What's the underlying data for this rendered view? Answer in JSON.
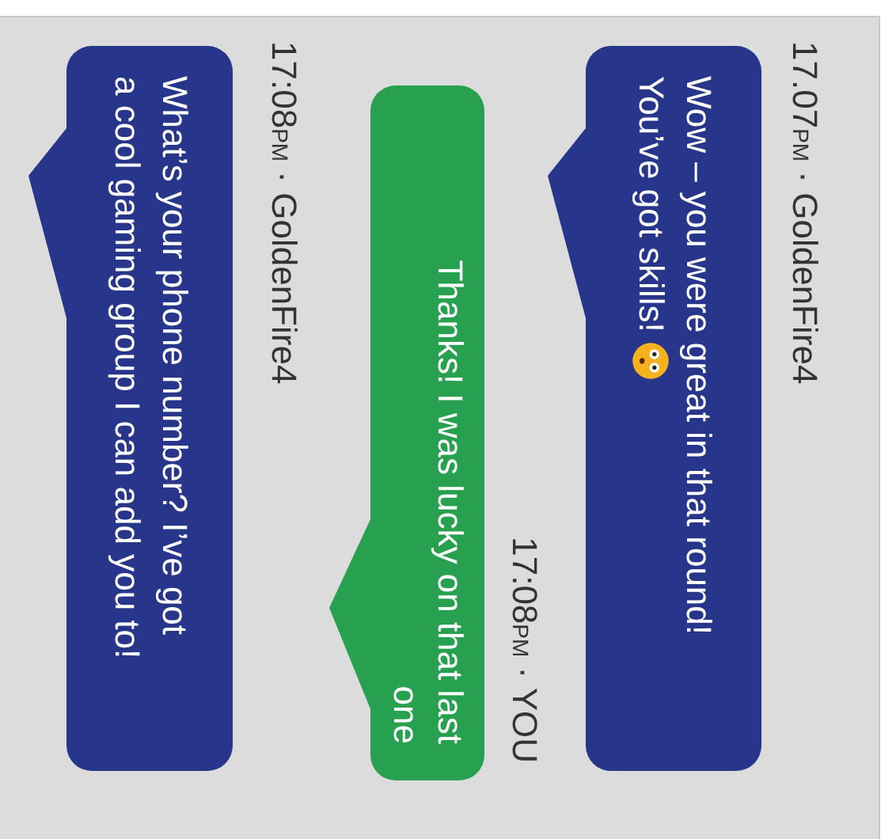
{
  "messages": [
    {
      "kind": "incoming",
      "time": "17.07",
      "meridiem": "PM",
      "separator": "·",
      "sender": "GoldenFire4",
      "lines": [
        "Wow – you were great in that round!",
        "You’ve got skills!"
      ],
      "emoji": true
    },
    {
      "kind": "outgoing",
      "time": "17:08",
      "meridiem": "PM",
      "separator": "·",
      "sender": "YOU",
      "lines": [
        "Thanks! I was lucky on that last",
        "one"
      ],
      "emoji": false
    },
    {
      "kind": "incoming",
      "time": "17:08",
      "meridiem": "PM",
      "separator": "·",
      "sender": "GoldenFire4",
      "lines": [
        "What’s your phone number? I’ve got",
        "a cool gaming group I can add you to!"
      ],
      "emoji": false
    }
  ]
}
